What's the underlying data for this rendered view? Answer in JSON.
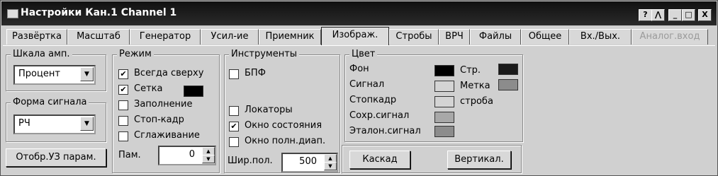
{
  "window": {
    "title": "Настройки Кан.1 Channel 1",
    "controls": [
      "?",
      "⋀",
      "_",
      "□",
      "X"
    ]
  },
  "tabs": [
    {
      "label": "Развёртка",
      "active": false,
      "disabled": false
    },
    {
      "label": "Масштаб",
      "active": false,
      "disabled": false
    },
    {
      "label": "Генератор",
      "active": false,
      "disabled": false
    },
    {
      "label": "Усил-ие",
      "active": false,
      "disabled": false
    },
    {
      "label": "Приемник",
      "active": false,
      "disabled": false
    },
    {
      "label": "Изображ.",
      "active": true,
      "disabled": false
    },
    {
      "label": "Стробы",
      "active": false,
      "disabled": false
    },
    {
      "label": "ВРЧ",
      "active": false,
      "disabled": false
    },
    {
      "label": "Файлы",
      "active": false,
      "disabled": false
    },
    {
      "label": "Общее",
      "active": false,
      "disabled": false
    },
    {
      "label": "Вх./Вых.",
      "active": false,
      "disabled": false
    },
    {
      "label": "Аналог.вход",
      "active": false,
      "disabled": true
    }
  ],
  "scale": {
    "legend": "Шкала амп.",
    "value": "Процент"
  },
  "signal_shape": {
    "legend": "Форма сигнала",
    "value": "РЧ"
  },
  "show_params_button": "Отобр.УЗ парам.",
  "mode": {
    "legend": "Режим",
    "items": [
      {
        "label": "Всегда сверху",
        "checked": true
      },
      {
        "label": "Сетка",
        "checked": true
      },
      {
        "label": "Заполнение",
        "checked": false
      },
      {
        "label": "Стоп-кадр",
        "checked": false
      },
      {
        "label": "Сглаживание",
        "checked": false
      }
    ],
    "grid_color": "#000000",
    "pam_label": "Пам.",
    "pam_value": "0"
  },
  "tools": {
    "legend": "Инструменты",
    "fft": {
      "label": "БПФ",
      "checked": false
    },
    "locators": {
      "label": "Локаторы",
      "checked": false
    },
    "status_window": {
      "label": "Окно состояния",
      "checked": true
    },
    "full_range_window": {
      "label": "Окно полн.диап.",
      "checked": false
    },
    "width_label": "Шир.пол.",
    "width_value": "500"
  },
  "color": {
    "legend": "Цвет",
    "left": [
      {
        "label": "Фон",
        "color": "#000000"
      },
      {
        "label": "Сигнал",
        "color": "#d4d4d4"
      },
      {
        "label": "Стопкадр",
        "color": "#d4d4d4"
      },
      {
        "label": "Сохр.сигнал",
        "color": "#a8a8a8"
      },
      {
        "label": "Эталон.сигнал",
        "color": "#8c8c8c"
      }
    ],
    "right": [
      {
        "label": "Стр.",
        "color": "#1a1a1a"
      },
      {
        "label": "Метка",
        "color": "#8c8c8c"
      },
      {
        "label": "строба",
        "color": null
      }
    ]
  },
  "cascade_button": "Каскад",
  "vertical_button": "Вертикал."
}
